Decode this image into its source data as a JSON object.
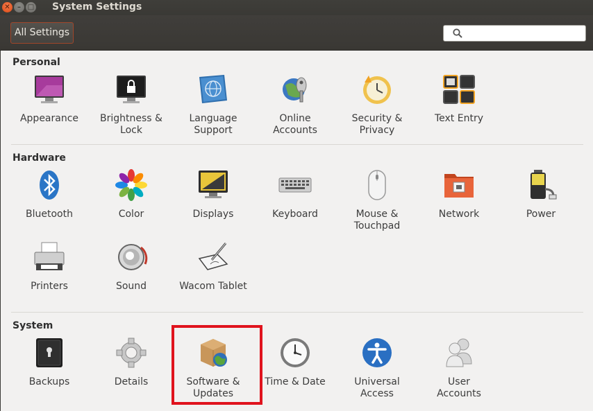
{
  "window": {
    "title": "System Settings"
  },
  "toolbar": {
    "all_settings_label": "All Settings",
    "search_placeholder": ""
  },
  "sections": {
    "personal": {
      "title": "Personal",
      "items": [
        {
          "label": "Appearance",
          "icon": "appearance-icon"
        },
        {
          "label": "Brightness &\nLock",
          "icon": "brightness-lock-icon"
        },
        {
          "label": "Language\nSupport",
          "icon": "language-support-icon"
        },
        {
          "label": "Online\nAccounts",
          "icon": "online-accounts-icon"
        },
        {
          "label": "Security &\nPrivacy",
          "icon": "security-privacy-icon"
        },
        {
          "label": "Text Entry",
          "icon": "text-entry-icon"
        }
      ]
    },
    "hardware": {
      "title": "Hardware",
      "items": [
        {
          "label": "Bluetooth",
          "icon": "bluetooth-icon"
        },
        {
          "label": "Color",
          "icon": "color-icon"
        },
        {
          "label": "Displays",
          "icon": "displays-icon"
        },
        {
          "label": "Keyboard",
          "icon": "keyboard-icon"
        },
        {
          "label": "Mouse &\nTouchpad",
          "icon": "mouse-touchpad-icon"
        },
        {
          "label": "Network",
          "icon": "network-icon"
        },
        {
          "label": "Power",
          "icon": "power-icon"
        },
        {
          "label": "Printers",
          "icon": "printers-icon"
        },
        {
          "label": "Sound",
          "icon": "sound-icon"
        },
        {
          "label": "Wacom Tablet",
          "icon": "wacom-tablet-icon"
        }
      ]
    },
    "system": {
      "title": "System",
      "items": [
        {
          "label": "Backups",
          "icon": "backups-icon"
        },
        {
          "label": "Details",
          "icon": "details-icon"
        },
        {
          "label": "Software &\nUpdates",
          "icon": "software-updates-icon"
        },
        {
          "label": "Time & Date",
          "icon": "time-date-icon"
        },
        {
          "label": "Universal\nAccess",
          "icon": "universal-access-icon"
        },
        {
          "label": "User\nAccounts",
          "icon": "user-accounts-icon"
        }
      ]
    }
  },
  "colors": {
    "highlight": "#e0131d",
    "accent": "#df4a16"
  }
}
